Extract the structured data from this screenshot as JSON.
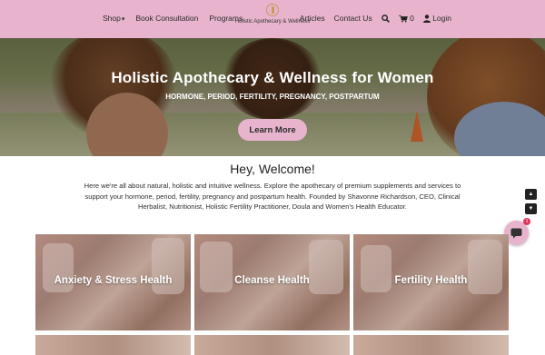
{
  "header": {
    "nav_left": [
      "Shop",
      "Book Consultation",
      "Programs"
    ],
    "logo_text": "Holistic Apothecary & Wellness",
    "nav_right": [
      "Articles",
      "Contact Us"
    ],
    "cart_count": "0",
    "login_label": "Login",
    "accent_color": "#e8b4cd"
  },
  "hero": {
    "title": "Holistic Apothecary & Wellness for Women",
    "subtitle": "HORMONE, PERIOD, FERTILITY, PREGNANCY, POSTPARTUM",
    "button_label": "Learn More"
  },
  "welcome": {
    "title": "Hey, Welcome!",
    "text": "Here we're all about natural, holistic and intuitive wellness. Explore the apothecary of premium supplements and services to support your hormone, period, fertility, pregnancy and postpartum health. Founded by Shavonne Richardson, CEO, Clinical Herbalist, Nutritionist, Holistic Fertility Practitioner, Doula and Women's Health Educator."
  },
  "chat": {
    "badge_count": "1"
  },
  "tiles": [
    {
      "label": "Anxiety & Stress Health"
    },
    {
      "label": "Cleanse Health"
    },
    {
      "label": "Fertility Health"
    }
  ]
}
